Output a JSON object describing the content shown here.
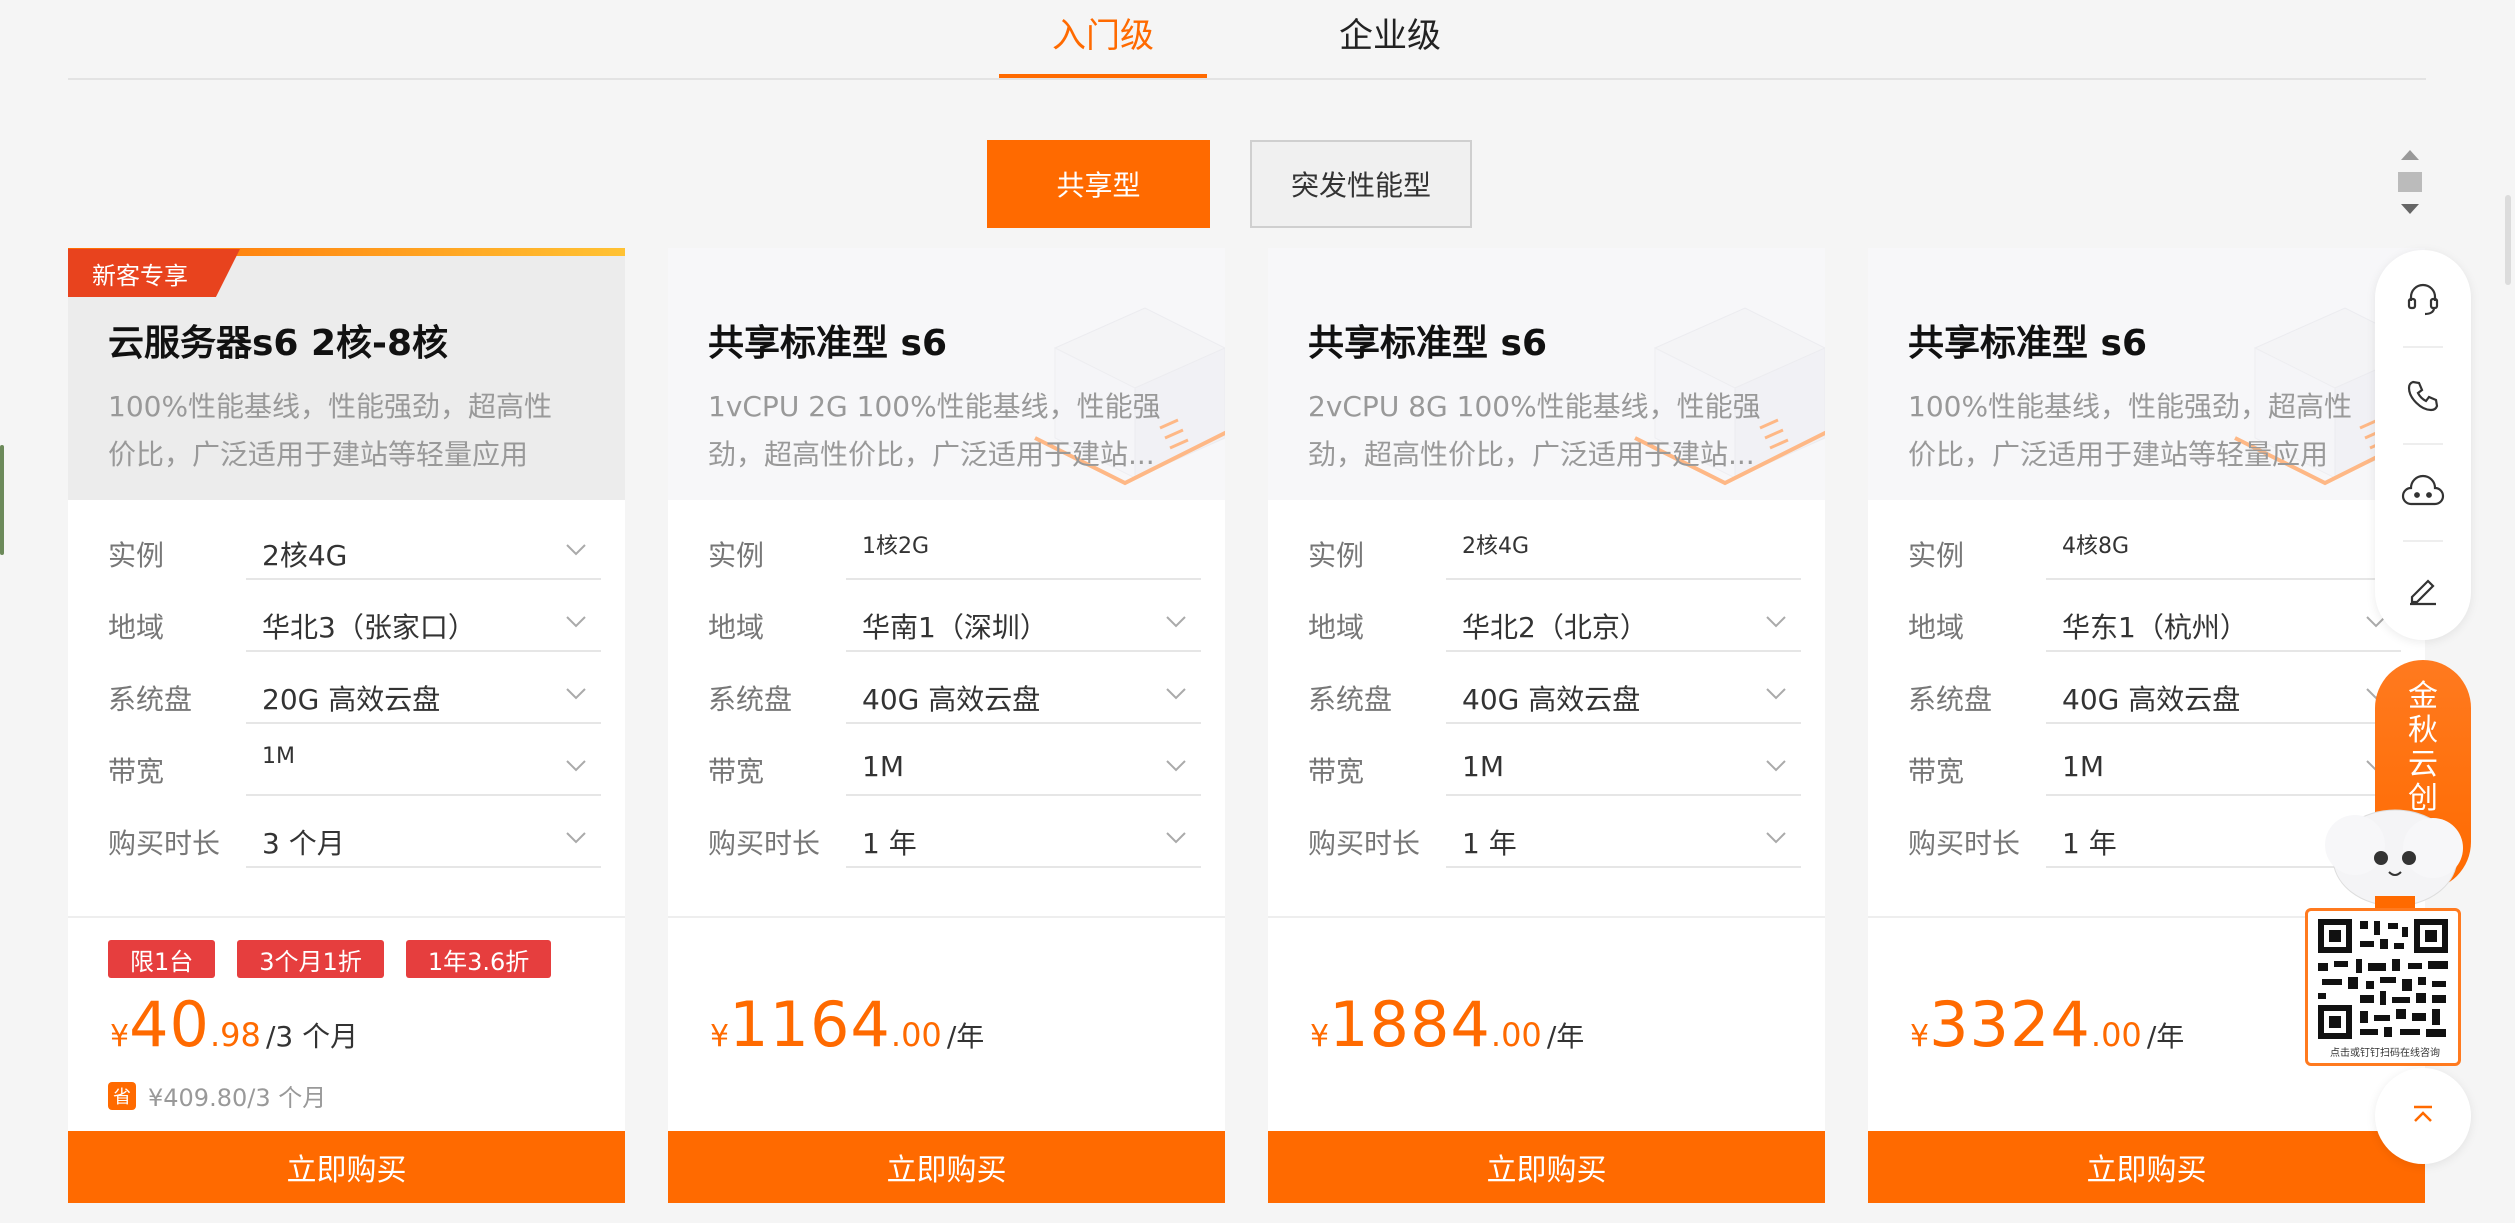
{
  "tabs": {
    "entry": "入门级",
    "enterprise": "企业级"
  },
  "subtabs": {
    "shared": "共享型",
    "burst": "突发性能型"
  },
  "labels": {
    "instance": "实例",
    "region": "地域",
    "disk": "系统盘",
    "bandwidth": "带宽",
    "duration": "购买时长"
  },
  "cards": [
    {
      "tag": "新客专享",
      "title": "云服务器s6 2核-8核",
      "desc": "100%性能基线，性能强劲，超高性价比，广泛适用于建站等轻量应用",
      "instance": "2核4G",
      "region": "华北3（张家口）",
      "disk": "20G 高效云盘",
      "bandwidth": "1M",
      "duration": "3 个月",
      "badges": [
        "限1台",
        "3个月1折",
        "1年3.6折"
      ],
      "currency": "¥",
      "price_int": "40",
      "price_dec": ".98",
      "price_unit": "/3 个月",
      "saved_icon": "省",
      "saved": "¥409.80/3 个月",
      "buy": "立即购买"
    },
    {
      "title": "共享标准型 s6",
      "desc": "1vCPU 2G 100%性能基线，性能强劲，超高性价比，广泛适用于建站...",
      "instance": "1核2G",
      "region": "华南1（深圳）",
      "disk": "40G 高效云盘",
      "bandwidth": "1M",
      "duration": "1 年",
      "currency": "¥",
      "price_int": "1164",
      "price_dec": ".00",
      "price_unit": "/年",
      "buy": "立即购买"
    },
    {
      "title": "共享标准型 s6",
      "desc": "2vCPU 8G 100%性能基线，性能强劲，超高性价比，广泛适用于建站...",
      "instance": "2核4G",
      "region": "华北2（北京）",
      "disk": "40G 高效云盘",
      "bandwidth": "1M",
      "duration": "1 年",
      "currency": "¥",
      "price_int": "1884",
      "price_dec": ".00",
      "price_unit": "/年",
      "buy": "立即购买"
    },
    {
      "title": "共享标准型 s6",
      "desc": "100%性能基线，性能强劲，超高性价比，广泛适用于建站等轻量应用",
      "instance": "4核8G",
      "region": "华东1（杭州）",
      "disk": "40G 高效云盘",
      "bandwidth": "1M",
      "duration": "1 年",
      "currency": "¥",
      "price_int": "3324",
      "price_dec": ".00",
      "price_unit": "/年",
      "buy": "立即购买"
    }
  ],
  "float": {
    "icons": [
      "headset-icon",
      "phone-icon",
      "chat-bot-icon",
      "edit-icon"
    ],
    "promo": [
      "金",
      "秋",
      "云",
      "创"
    ],
    "qr_caption": "点击或钉钉扫码在线咨询",
    "accent": "#ff6a00"
  }
}
